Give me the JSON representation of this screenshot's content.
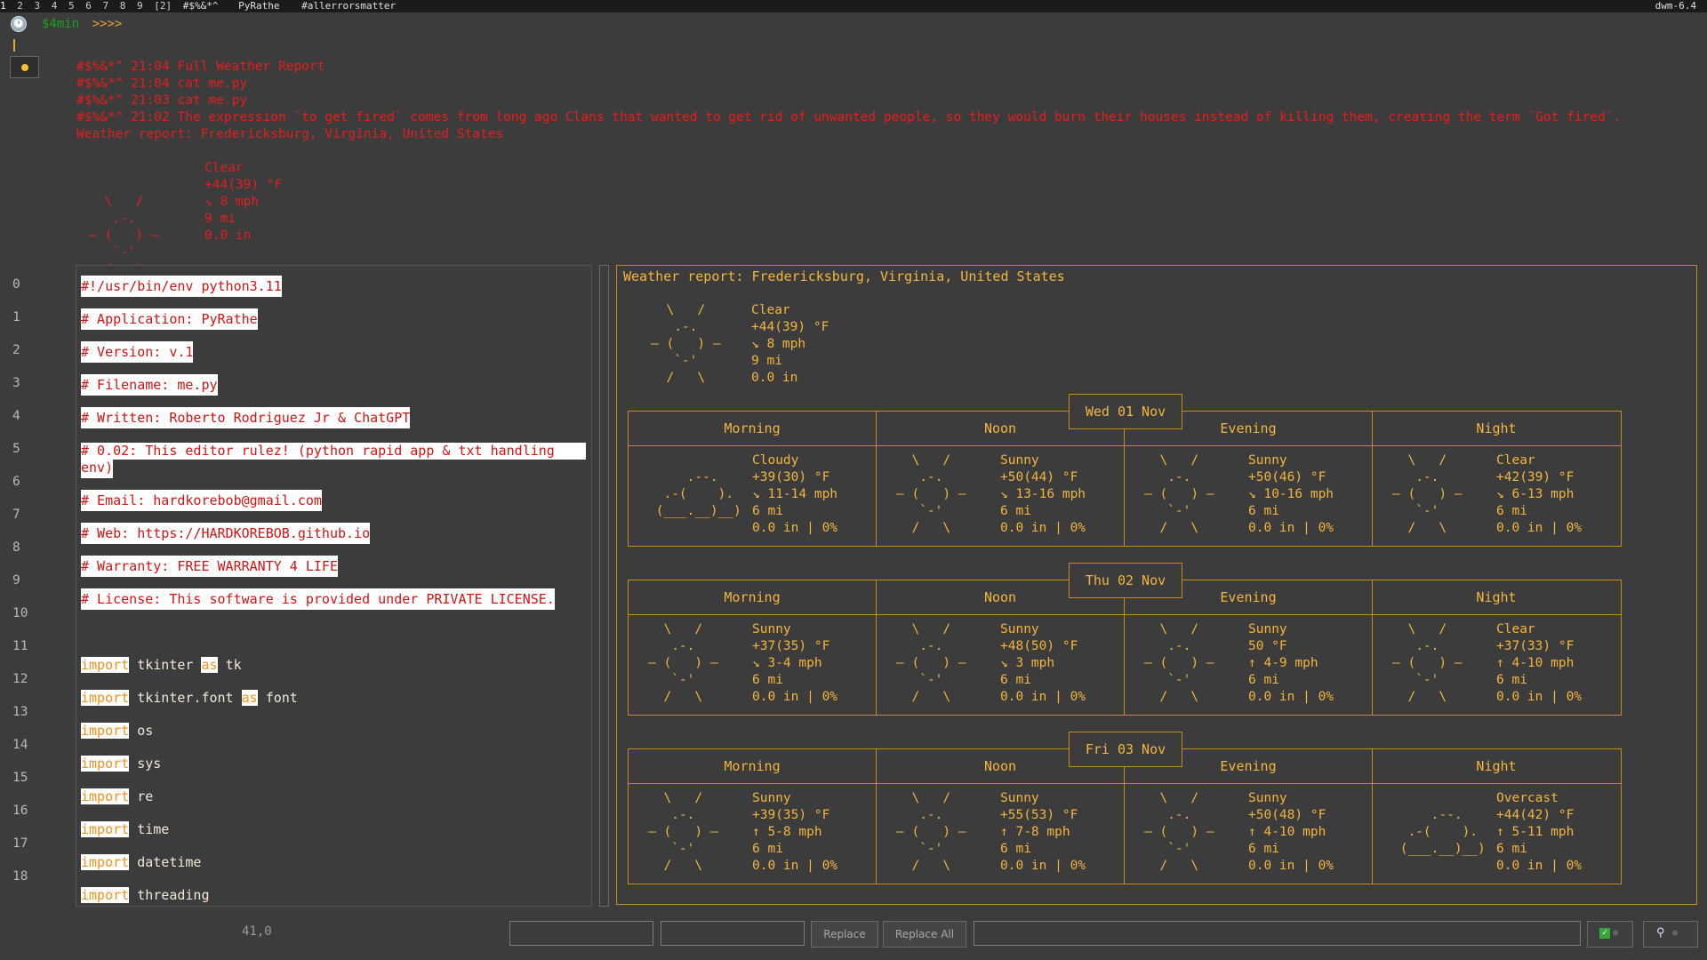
{
  "topbar": {
    "tags": [
      "1",
      "2",
      "3",
      "4",
      "5",
      "6",
      "7",
      "8",
      "9",
      "[2]"
    ],
    "layout_symbol": "#$%&*^",
    "app_name": "PyRathe",
    "window_title": "#allerrorsmatter",
    "status_right": "dwm-6.4"
  },
  "prompt": {
    "user": "$4min",
    "arrows": ">>>>"
  },
  "terminal": {
    "lines": [
      "#$%&*^ 21:04 Full Weather Report",
      "#$%&*^ 21:04 cat me.py",
      "#$%&*^ 21:03 cat me.py",
      "#$%&*^ 21:02 The expression `to get fired` comes from long ago Clans that wanted to get rid of unwanted people, so they would burn their houses instead of killing them, creating the term `Got fired`.",
      "Weather report: Fredericksburg, Virginia, United States"
    ],
    "current": {
      "art": "  \\   /    \n   .-.     \n― (   ) ―  \n   `-'     \n  /   \\    ",
      "values": "Clear\n+44(39) °F\n↘ 8 mph\n9 mi\n0.0 in"
    }
  },
  "editor": {
    "line_numbers": [
      "0",
      "1",
      "2",
      "3",
      "4",
      "5",
      "6",
      "7",
      "8",
      "9",
      "10",
      "11",
      "12",
      "13",
      "14",
      "15",
      "16",
      "17",
      "18"
    ],
    "comment_lines": [
      "#!/usr/bin/env python3.11",
      "# Application: PyRathe",
      "# Version: v.1",
      "# Filename: me.py",
      "# Written: Roberto Rodriguez Jr & ChatGPT",
      "# 0.02: This editor rulez! (python rapid app & txt handling",
      "env)",
      "# Email: hardkorebob@gmail.com",
      "# Web: https://HARDKOREBOB.github.io",
      "# Warranty: FREE WARRANTY 4 LIFE",
      "# License: This software is provided under PRIVATE LICENSE."
    ],
    "imports": [
      {
        "kw": "import",
        "mod": "tkinter",
        "as": "as",
        "alias": "tk"
      },
      {
        "kw": "import",
        "mod": "tkinter.font",
        "as": "as",
        "alias": "font"
      },
      {
        "kw": "import",
        "mod": "os"
      },
      {
        "kw": "import",
        "mod": "sys"
      },
      {
        "kw": "import",
        "mod": "re"
      },
      {
        "kw": "import",
        "mod": "time"
      },
      {
        "kw": "import",
        "mod": "datetime"
      },
      {
        "kw": "import",
        "mod": "threading"
      }
    ],
    "cursor_position": "41,0"
  },
  "weather": {
    "title": "Weather report: Fredericksburg, Virginia, United States",
    "current": {
      "art": "  \\   /    \n   .-.     \n― (   ) ―  \n   `-'     \n  /   \\    ",
      "values": "Clear\n+44(39) °F\n↘ 8 mph\n9 mi\n0.0 in"
    },
    "periods": [
      "Morning",
      "Noon",
      "Evening",
      "Night"
    ],
    "days": [
      {
        "date": "Wed 01 Nov",
        "cells": [
          {
            "art": "            \n     .--.   \n  .-(    ). \n (___.__)__)\n            ",
            "values": "Cloudy\n+39(30) °F\n↘ 11-14 mph\n6 mi\n0.0 in | 0%"
          },
          {
            "art": "  \\   /    \n   .-.     \n― (   ) ―  \n   `-'     \n  /   \\    ",
            "values": "Sunny\n+50(44) °F\n↘ 13-16 mph\n6 mi\n0.0 in | 0%"
          },
          {
            "art": "  \\   /    \n   .-.     \n― (   ) ―  \n   `-'     \n  /   \\    ",
            "values": "Sunny\n+50(46) °F\n↘ 10-16 mph\n6 mi\n0.0 in | 0%"
          },
          {
            "art": "  \\   /    \n   .-.     \n― (   ) ―  \n   `-'     \n  /   \\    ",
            "values": "Clear\n+42(39) °F\n↘ 6-13 mph\n6 mi\n0.0 in | 0%"
          }
        ]
      },
      {
        "date": "Thu 02 Nov",
        "cells": [
          {
            "art": "  \\   /    \n   .-.     \n― (   ) ―  \n   `-'     \n  /   \\    ",
            "values": "Sunny\n+37(35) °F\n↘ 3-4 mph\n6 mi\n0.0 in | 0%"
          },
          {
            "art": "  \\   /    \n   .-.     \n― (   ) ―  \n   `-'     \n  /   \\    ",
            "values": "Sunny\n+48(50) °F\n↘ 3 mph\n6 mi\n0.0 in | 0%"
          },
          {
            "art": "  \\   /    \n   .-.     \n― (   ) ―  \n   `-'     \n  /   \\    ",
            "values": "Sunny\n50 °F\n↑ 4-9 mph\n6 mi\n0.0 in | 0%"
          },
          {
            "art": "  \\   /    \n   .-.     \n― (   ) ―  \n   `-'     \n  /   \\    ",
            "values": "Clear\n+37(33) °F\n↑ 4-10 mph\n6 mi\n0.0 in | 0%"
          }
        ]
      },
      {
        "date": "Fri 03 Nov",
        "cells": [
          {
            "art": "  \\   /    \n   .-.     \n― (   ) ―  \n   `-'     \n  /   \\    ",
            "values": "Sunny\n+39(35) °F\n↑ 5-8 mph\n6 mi\n0.0 in | 0%"
          },
          {
            "art": "  \\   /    \n   .-.     \n― (   ) ―  \n   `-'     \n  /   \\    ",
            "values": "Sunny\n+55(53) °F\n↑ 7-8 mph\n6 mi\n0.0 in | 0%"
          },
          {
            "art": "  \\   /    \n   .-.     \n― (   ) ―  \n   `-'     \n  /   \\    ",
            "values": "Sunny\n+50(48) °F\n↑ 4-10 mph\n6 mi\n0.0 in | 0%"
          },
          {
            "art": "            \n     .--.   \n  .-(    ). \n (___.__)__)\n            ",
            "values": "Overcast\n+44(42) °F\n↑ 5-11 mph\n6 mi\n0.0 in | 0%"
          }
        ]
      }
    ]
  },
  "bottombar": {
    "replace_label": "Replace",
    "replace_all_label": "Replace All"
  },
  "colors": {
    "accent_orange": "#f3b53f",
    "terminal_red": "#e21e1e",
    "background": "#3c3c3c"
  }
}
